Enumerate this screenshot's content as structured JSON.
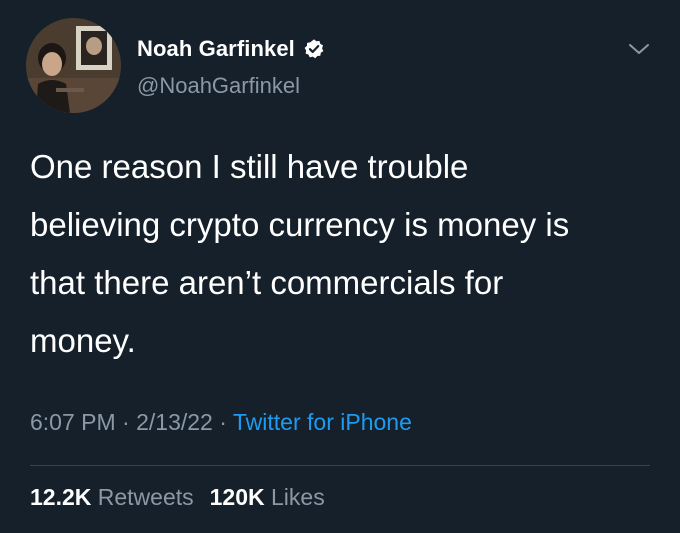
{
  "author": {
    "display_name": "Noah Garfinkel",
    "handle": "@NoahGarfinkel",
    "verified": true
  },
  "tweet": {
    "text_lines": [
      "One reason I still have trouble",
      "believing crypto currency is money is",
      "that there aren’t commercials for",
      "money."
    ]
  },
  "meta": {
    "time": "6:07 PM",
    "separator": "·",
    "date": "2/13/22",
    "source": "Twitter for iPhone"
  },
  "stats": {
    "retweets_count": "12.2K",
    "retweets_label": "Retweets",
    "likes_count": "120K",
    "likes_label": "Likes"
  },
  "colors": {
    "background": "#15202b",
    "primary_text": "#ffffff",
    "secondary_text": "#8b98a5",
    "accent": "#1d9bf0",
    "divider": "#38444d"
  },
  "icons": {
    "verified": "verified-badge-icon",
    "menu": "chevron-down-icon"
  }
}
